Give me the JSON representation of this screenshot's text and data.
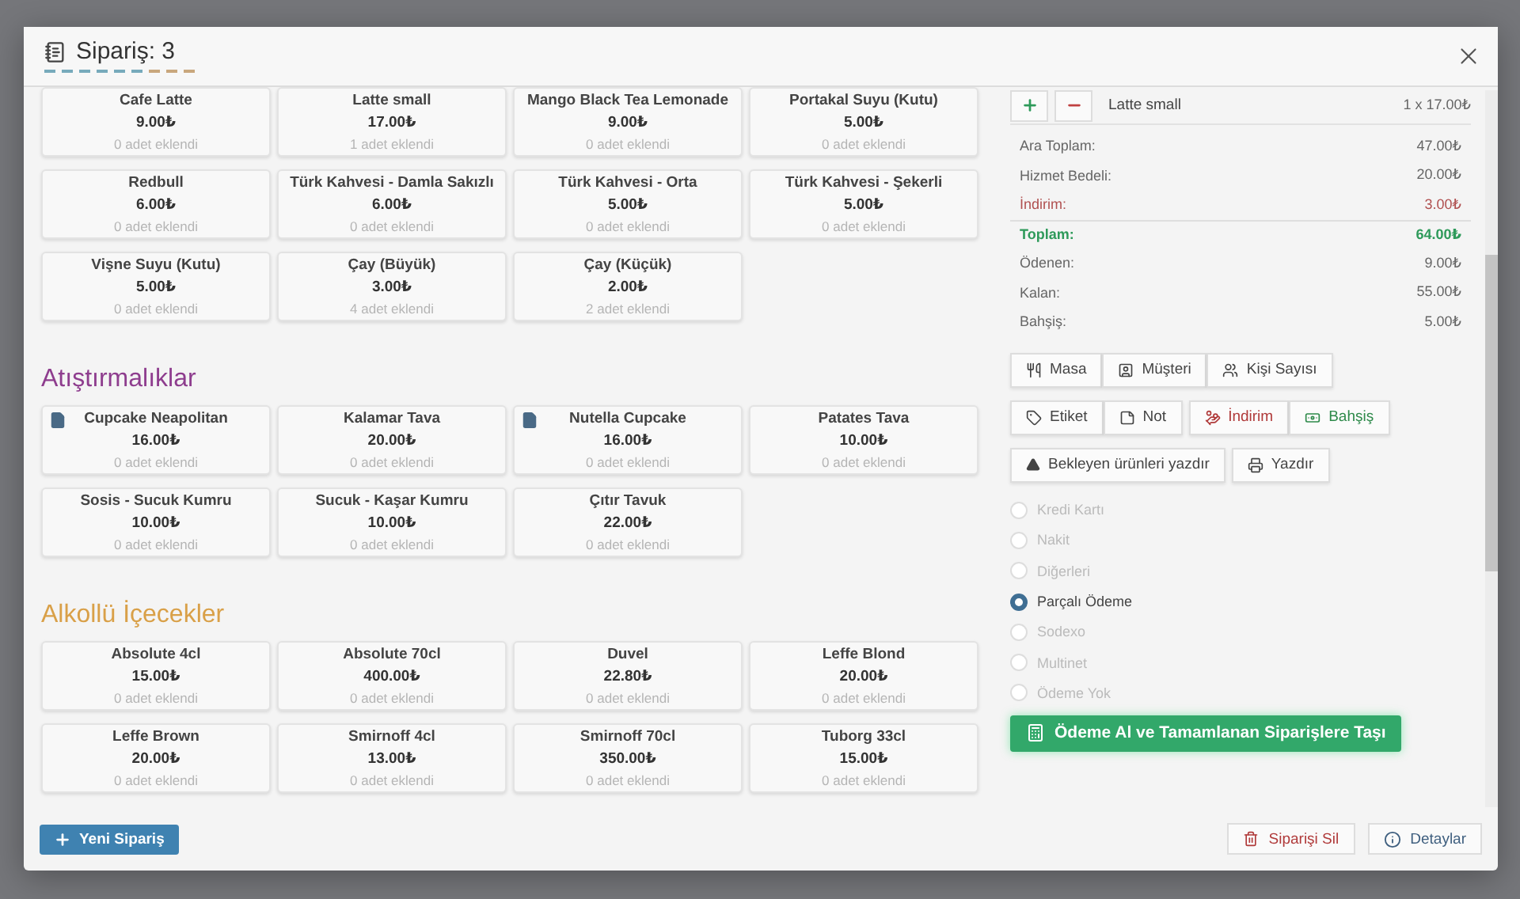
{
  "modal": {
    "title": "Sipariş: 3"
  },
  "categories": [
    {
      "items": [
        {
          "name": "Cafe Latte",
          "price": "9.00₺",
          "added": "0 adet eklendi"
        },
        {
          "name": "Latte small",
          "price": "17.00₺",
          "added": "1 adet eklendi"
        },
        {
          "name": "Mango Black Tea Lemonade",
          "price": "9.00₺",
          "added": "0 adet eklendi"
        },
        {
          "name": "Portakal Suyu (Kutu)",
          "price": "5.00₺",
          "added": "0 adet eklendi"
        },
        {
          "name": "Redbull",
          "price": "6.00₺",
          "added": "0 adet eklendi"
        },
        {
          "name": "Türk Kahvesi - Damla Sakızlı",
          "price": "6.00₺",
          "added": "0 adet eklendi"
        },
        {
          "name": "Türk Kahvesi - Orta",
          "price": "5.00₺",
          "added": "0 adet eklendi"
        },
        {
          "name": "Türk Kahvesi - Şekerli",
          "price": "5.00₺",
          "added": "0 adet eklendi"
        },
        {
          "name": "Vişne Suyu (Kutu)",
          "price": "5.00₺",
          "added": "0 adet eklendi"
        },
        {
          "name": "Çay (Büyük)",
          "price": "3.00₺",
          "added": "4 adet eklendi"
        },
        {
          "name": "Çay (Küçük)",
          "price": "2.00₺",
          "added": "2 adet eklendi"
        }
      ]
    },
    {
      "title": "Atıştırmalıklar",
      "color": "#8e3d8e",
      "items": [
        {
          "name": "Cupcake Neapolitan",
          "price": "16.00₺",
          "added": "0 adet eklendi",
          "has_note": true
        },
        {
          "name": "Kalamar Tava",
          "price": "20.00₺",
          "added": "0 adet eklendi"
        },
        {
          "name": "Nutella Cupcake",
          "price": "16.00₺",
          "added": "0 adet eklendi",
          "has_note": true
        },
        {
          "name": "Patates Tava",
          "price": "10.00₺",
          "added": "0 adet eklendi"
        },
        {
          "name": "Sosis - Sucuk Kumru",
          "price": "10.00₺",
          "added": "0 adet eklendi"
        },
        {
          "name": "Sucuk - Kaşar Kumru",
          "price": "10.00₺",
          "added": "0 adet eklendi"
        },
        {
          "name": "Çıtır Tavuk",
          "price": "22.00₺",
          "added": "0 adet eklendi"
        }
      ]
    },
    {
      "title": "Alkollü İçecekler",
      "color": "#d9a048",
      "items": [
        {
          "name": "Absolute 4cl",
          "price": "15.00₺",
          "added": "0 adet eklendi"
        },
        {
          "name": "Absolute 70cl",
          "price": "400.00₺",
          "added": "0 adet eklendi"
        },
        {
          "name": "Duvel",
          "price": "22.80₺",
          "added": "0 adet eklendi"
        },
        {
          "name": "Leffe Blond",
          "price": "20.00₺",
          "added": "0 adet eklendi"
        },
        {
          "name": "Leffe Brown",
          "price": "20.00₺",
          "added": "0 adet eklendi"
        },
        {
          "name": "Smirnoff 4cl",
          "price": "13.00₺",
          "added": "0 adet eklendi"
        },
        {
          "name": "Smirnoff 70cl",
          "price": "350.00₺",
          "added": "0 adet eklendi"
        },
        {
          "name": "Tuborg 33cl",
          "price": "15.00₺",
          "added": "0 adet eklendi"
        }
      ]
    }
  ],
  "order_items": [
    {
      "name": "Latte small",
      "quantity": "1 x 17.00₺"
    }
  ],
  "totals": [
    {
      "label": "Ara Toplam:",
      "value": "47.00₺",
      "kind": "normal"
    },
    {
      "label": "Hizmet Bedeli:",
      "value": "20.00₺",
      "kind": "normal"
    },
    {
      "label": "İndirim:",
      "value": "3.00₺",
      "kind": "discount"
    },
    {
      "label": "Toplam:",
      "value": "64.00₺",
      "kind": "total"
    },
    {
      "label": "Ödenen:",
      "value": "9.00₺",
      "kind": "normal"
    },
    {
      "label": "Kalan:",
      "value": "55.00₺",
      "kind": "normal"
    },
    {
      "label": "Bahşiş:",
      "value": "5.00₺",
      "kind": "normal"
    }
  ],
  "action_groups": [
    [
      {
        "label": "Masa",
        "kind": "table"
      },
      {
        "label": "Müşteri",
        "kind": "customer"
      },
      {
        "label": "Kişi Sayısı",
        "kind": "people"
      }
    ],
    [
      {
        "label": "Etiket",
        "kind": "tag"
      },
      {
        "label": "Not",
        "kind": "note"
      },
      {
        "label": "İndirim",
        "kind": "discount"
      },
      {
        "label": "Bahşiş",
        "kind": "tip"
      }
    ],
    [
      {
        "label": "Bekleyen ürünleri yazdır",
        "kind": "print_pending"
      },
      {
        "label": "Yazdır",
        "kind": "print"
      }
    ]
  ],
  "payment_methods": [
    {
      "label": "Kredi Kartı",
      "selected": false
    },
    {
      "label": "Nakit",
      "selected": false
    },
    {
      "label": "Diğerleri",
      "selected": false
    },
    {
      "label": "Parçalı Ödeme",
      "selected": true
    },
    {
      "label": "Sodexo",
      "selected": false
    },
    {
      "label": "Multinet",
      "selected": false
    },
    {
      "label": "Ödeme Yok",
      "selected": false
    }
  ],
  "pay_button": "Ödeme Al ve Tamamlanan Siparişlere Taşı",
  "footer": {
    "new_order": "Yeni Sipariş",
    "delete": "Siparişi Sil",
    "details": "Detaylar"
  }
}
